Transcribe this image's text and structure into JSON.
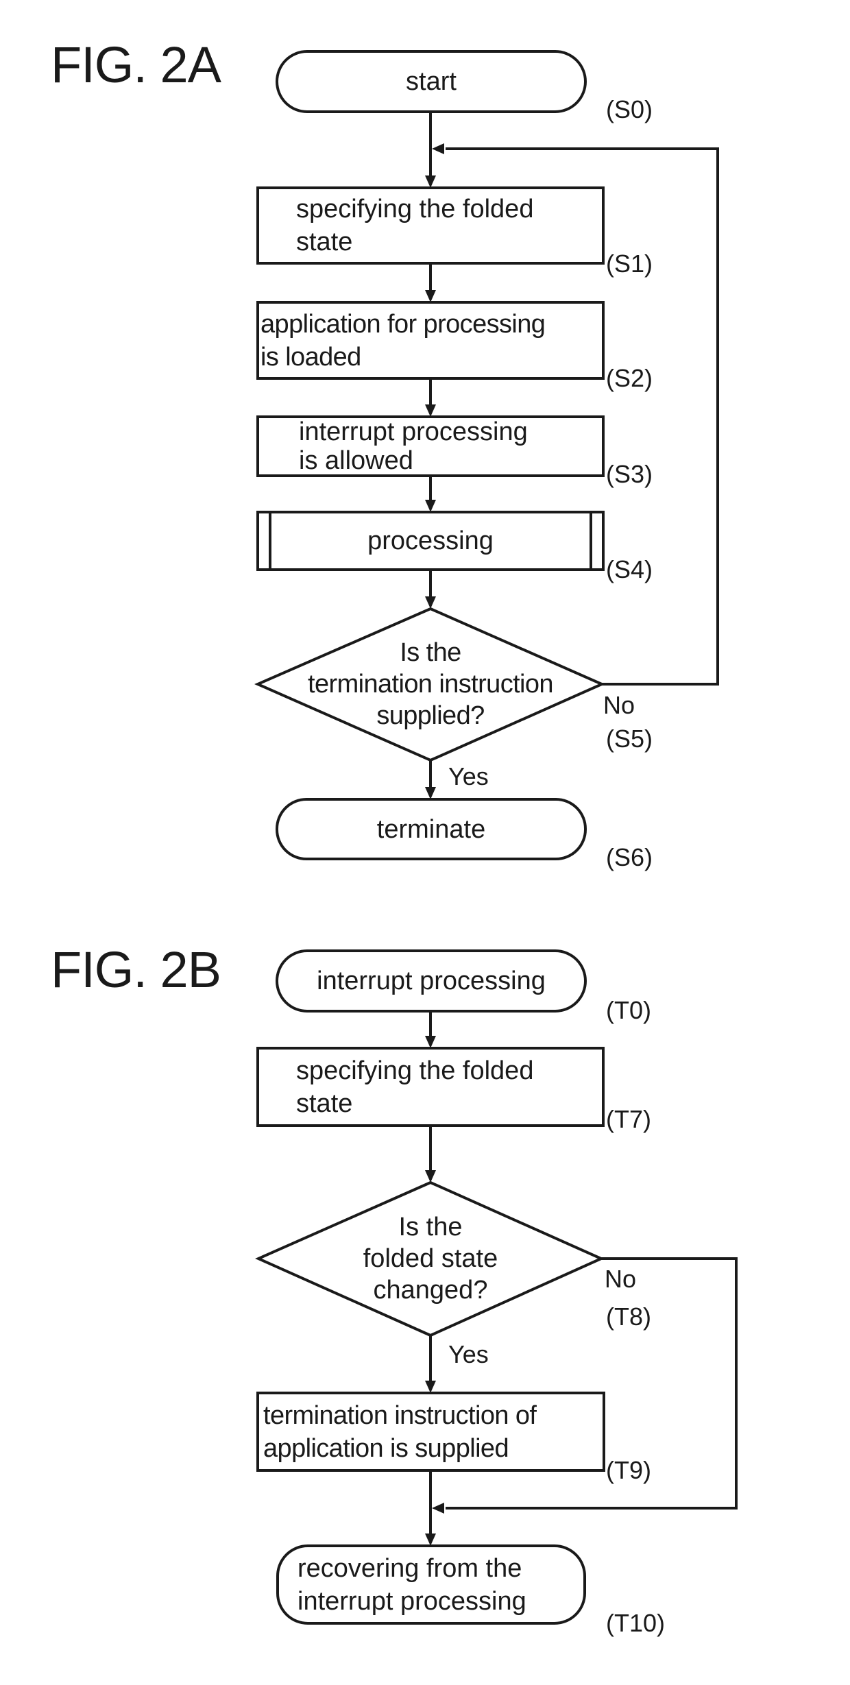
{
  "figures": [
    {
      "id": "fig2a",
      "label": "FIG. 2A",
      "nodes": [
        {
          "key": "S0",
          "shape": "terminal",
          "text": "start",
          "step": "(S0)"
        },
        {
          "key": "S1",
          "shape": "process",
          "text": "specifying the folded\nstate",
          "step": "(S1)"
        },
        {
          "key": "S2",
          "shape": "process",
          "text": "application for processing\nis loaded",
          "step": "(S2)"
        },
        {
          "key": "S3",
          "shape": "process",
          "text": "interrupt processing\nis allowed",
          "step": "(S3)"
        },
        {
          "key": "S4",
          "shape": "predefined-process",
          "text": "processing",
          "step": "(S4)"
        },
        {
          "key": "S5",
          "shape": "decision",
          "text": "Is the\ntermination instruction\nsupplied?",
          "step": "(S5)"
        },
        {
          "key": "S6",
          "shape": "terminal",
          "text": "terminate",
          "step": "(S6)"
        }
      ],
      "branches": {
        "no": "No",
        "yes": "Yes"
      },
      "edges": [
        {
          "from": "S0",
          "to": "S1"
        },
        {
          "from": "S1",
          "to": "S2"
        },
        {
          "from": "S2",
          "to": "S3"
        },
        {
          "from": "S3",
          "to": "S4"
        },
        {
          "from": "S4",
          "to": "S5"
        },
        {
          "from": "S5",
          "to": "S6",
          "label": "Yes"
        },
        {
          "from": "S5",
          "to": "S1",
          "label": "No"
        }
      ]
    },
    {
      "id": "fig2b",
      "label": "FIG. 2B",
      "nodes": [
        {
          "key": "T0",
          "shape": "terminal",
          "text": "interrupt processing",
          "step": "(T0)"
        },
        {
          "key": "T7",
          "shape": "process",
          "text": "specifying the folded\nstate",
          "step": "(T7)"
        },
        {
          "key": "T8",
          "shape": "decision",
          "text": "Is the\nfolded state\nchanged?",
          "step": "(T8)"
        },
        {
          "key": "T9",
          "shape": "process",
          "text": "termination instruction of\napplication is supplied",
          "step": "(T9)"
        },
        {
          "key": "T10",
          "shape": "terminal",
          "text": "recovering from the\ninterrupt processing",
          "step": "(T10)"
        }
      ],
      "branches": {
        "no": "No",
        "yes": "Yes"
      },
      "edges": [
        {
          "from": "T0",
          "to": "T7"
        },
        {
          "from": "T7",
          "to": "T8"
        },
        {
          "from": "T8",
          "to": "T9",
          "label": "Yes"
        },
        {
          "from": "T8",
          "to": "T10",
          "label": "No"
        },
        {
          "from": "T9",
          "to": "T10"
        }
      ]
    }
  ],
  "colors": {
    "ink": "#1a1a1a",
    "paper": "#ffffff"
  }
}
